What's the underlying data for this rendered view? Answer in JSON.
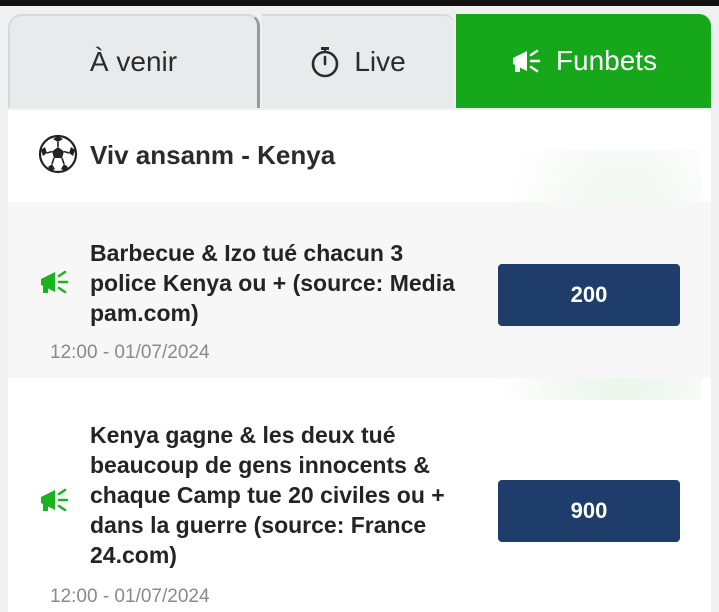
{
  "tabs": [
    {
      "label": "À venir",
      "active": false
    },
    {
      "label": "Live",
      "active": false,
      "icon": "stopwatch-icon"
    },
    {
      "label": "Funbets",
      "active": true,
      "icon": "megaphone-icon"
    }
  ],
  "section": {
    "title": "Viv ansanm - Kenya",
    "icon": "soccer-ball-icon"
  },
  "bets": [
    {
      "text": "Barbecue & Izo tué chacun 3 police Kenya ou + (source: Media pam.com)",
      "odds": "200",
      "time": "12:00 - 01/07/2024"
    },
    {
      "text": "Kenya gagne & les deux tué beaucoup de gens innocents & chaque Camp tue 20 civiles ou + dans la guerre  (source: France 24.com)",
      "odds": "900",
      "time": "12:00 - 01/07/2024"
    }
  ],
  "colors": {
    "active_tab": "#16a81a",
    "odds_button": "#1e3d6b",
    "megaphone": "#1bb21f"
  }
}
